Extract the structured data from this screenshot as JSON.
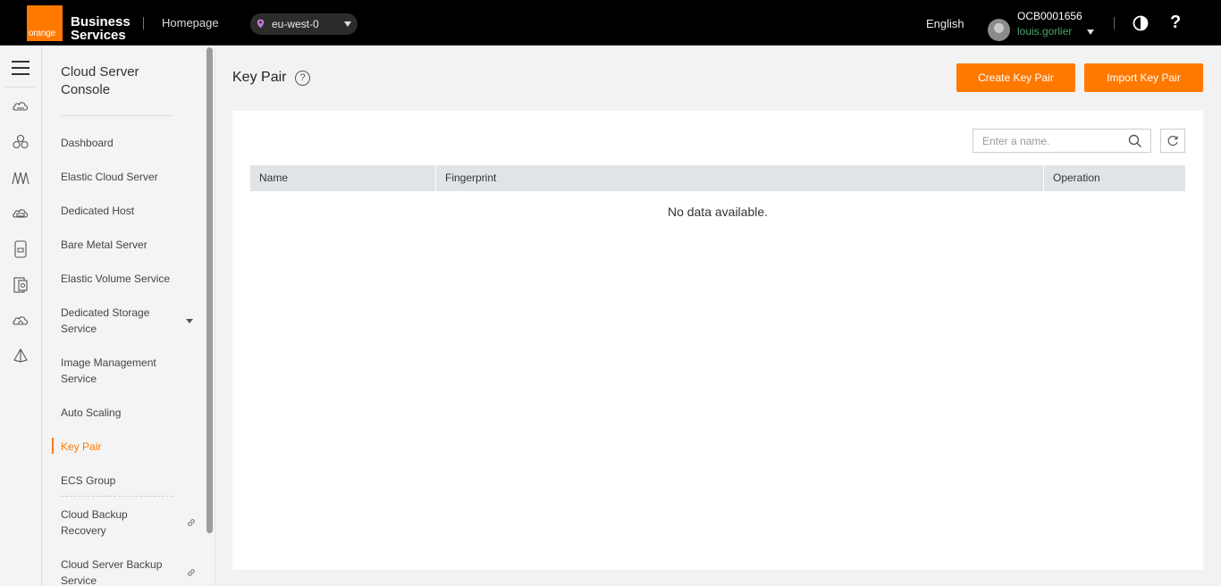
{
  "header": {
    "logo_text": "orange",
    "brand_line1": "Business",
    "brand_line2": "Services",
    "homepage": "Homepage",
    "region": "eu-west-0",
    "language": "English",
    "account_id": "OCB0001656",
    "username": "louis.gorlier",
    "help_glyph": "?"
  },
  "sidebar": {
    "title": "Cloud Server Console",
    "items": [
      {
        "label": "Dashboard"
      },
      {
        "label": "Elastic Cloud Server"
      },
      {
        "label": "Dedicated Host"
      },
      {
        "label": "Bare Metal Server"
      },
      {
        "label": "Elastic Volume Service"
      },
      {
        "label": "Dedicated Storage Service"
      },
      {
        "label": "Image Management Service"
      },
      {
        "label": "Auto Scaling"
      },
      {
        "label": "Key Pair"
      },
      {
        "label": "ECS Group"
      },
      {
        "label": "Cloud Backup Recovery"
      },
      {
        "label": "Cloud Server Backup Service"
      }
    ],
    "active": "Key Pair"
  },
  "rail_icons": [
    "menu-icon",
    "cloud-server-icon",
    "cluster-icon",
    "network-icon",
    "storage-icon",
    "container-icon",
    "database-icon",
    "cloud-sync-icon",
    "deploy-icon"
  ],
  "main": {
    "title": "Key Pair",
    "create_button": "Create Key Pair",
    "import_button": "Import Key Pair",
    "search_placeholder": "Enter a name.",
    "columns": [
      "Name",
      "Fingerprint",
      "Operation"
    ],
    "empty_text": "No data available."
  },
  "colors": {
    "accent": "#ff7900",
    "username": "#4aa66d",
    "topbar": "#000000"
  }
}
